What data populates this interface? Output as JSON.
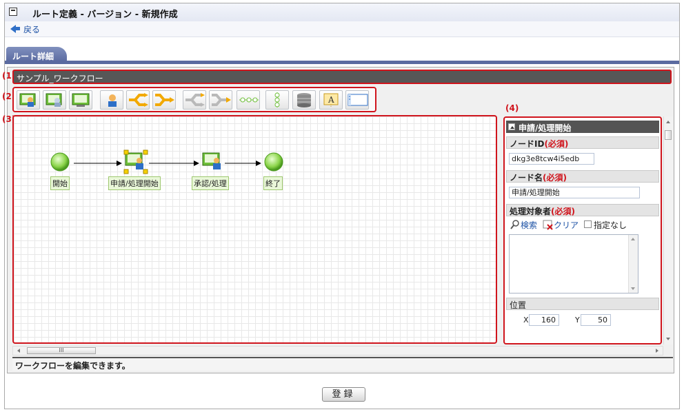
{
  "title": "ルート定義 - バージョン - 新規作成",
  "back_label": "戻る",
  "tab_label": "ルート詳細",
  "flow_name": "サンプル_ワークフロー",
  "callouts": [
    "(1)",
    "(2)",
    "(3)",
    "(4)"
  ],
  "toolbar_icons": [
    "user-node-icon",
    "user-node-alt-icon",
    "system-node-icon",
    "person-icon",
    "branch-icon",
    "join-icon",
    "branch-alt-icon",
    "join-alt-icon",
    "dotted-line-icon",
    "vertical-flow-icon",
    "database-icon",
    "text-annotation-icon",
    "frame-icon"
  ],
  "nodes": [
    {
      "label": "開始",
      "kind": "start"
    },
    {
      "label": "申請/処理開始",
      "kind": "user",
      "selected": true
    },
    {
      "label": "承認/処理",
      "kind": "user"
    },
    {
      "label": "終了",
      "kind": "end"
    }
  ],
  "properties": {
    "header": "申請/処理開始",
    "required_mark": "(必須)",
    "node_id_label": "ノードID",
    "node_id_value": "dkg3e8tcw4i5edb",
    "node_name_label": "ノード名",
    "node_name_value": "申請/処理開始",
    "target_label": "処理対象者",
    "search_label": "検索",
    "clear_label": "クリア",
    "no_target_label": "指定なし",
    "position_label": "位置",
    "x_label": "X",
    "x_value": "160",
    "y_label": "Y",
    "y_value": "50"
  },
  "status_text": "ワークフローを編集できます。",
  "register_button": "登録",
  "scroll_thumb_label": "III",
  "colors": {
    "callout": "#d0141c",
    "tab": "#5a6aa0",
    "node_green": "#8bd44a"
  }
}
